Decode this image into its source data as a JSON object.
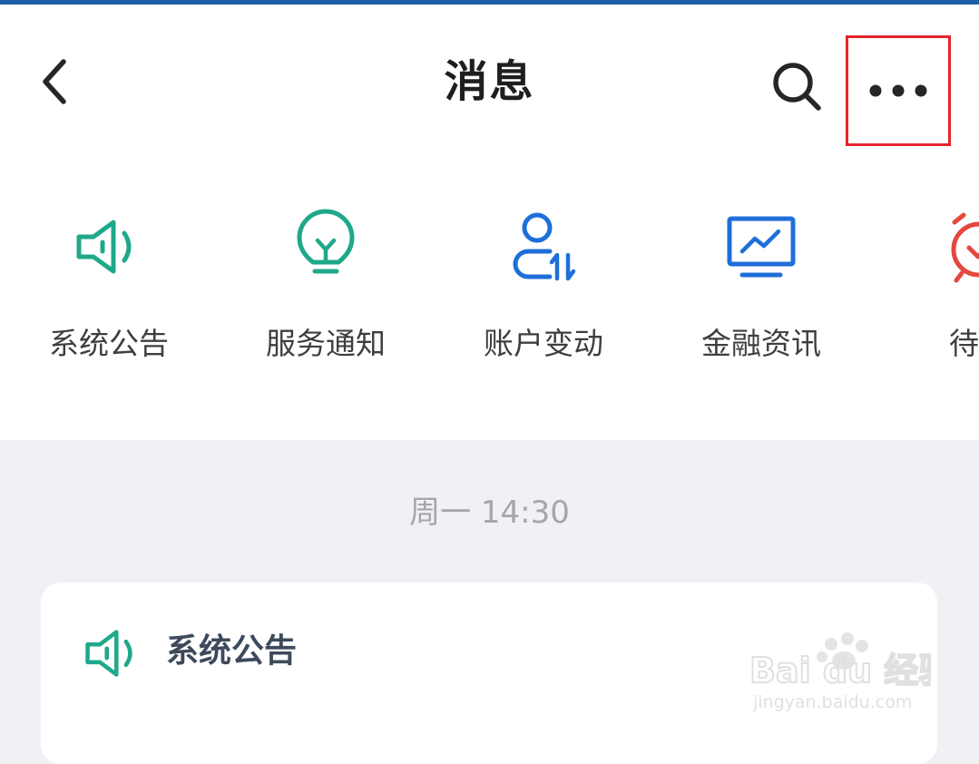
{
  "header": {
    "title": "消息",
    "back_icon": "chevron-left-icon",
    "search_icon": "search-icon",
    "more_icon": "more-horizontal-icon",
    "highlight_color": "#e5232b"
  },
  "categories": [
    {
      "label": "系统公告",
      "icon": "speaker-icon",
      "color": "#1fa88a"
    },
    {
      "label": "服务通知",
      "icon": "lightbulb-icon",
      "color": "#1fa88a"
    },
    {
      "label": "账户变动",
      "icon": "user-transfer-icon",
      "color": "#1e6fd9"
    },
    {
      "label": "金融资讯",
      "icon": "monitor-chart-icon",
      "color": "#1e6fd9"
    },
    {
      "label": "待办",
      "icon": "alarm-clock-icon",
      "color": "#e5473f"
    }
  ],
  "feed": {
    "timestamp": "周一 14:30",
    "card": {
      "title": "系统公告",
      "icon": "speaker-icon"
    }
  },
  "watermark": {
    "logo_text": "Bai du 经验",
    "url": "jingyan.baidu.com"
  }
}
